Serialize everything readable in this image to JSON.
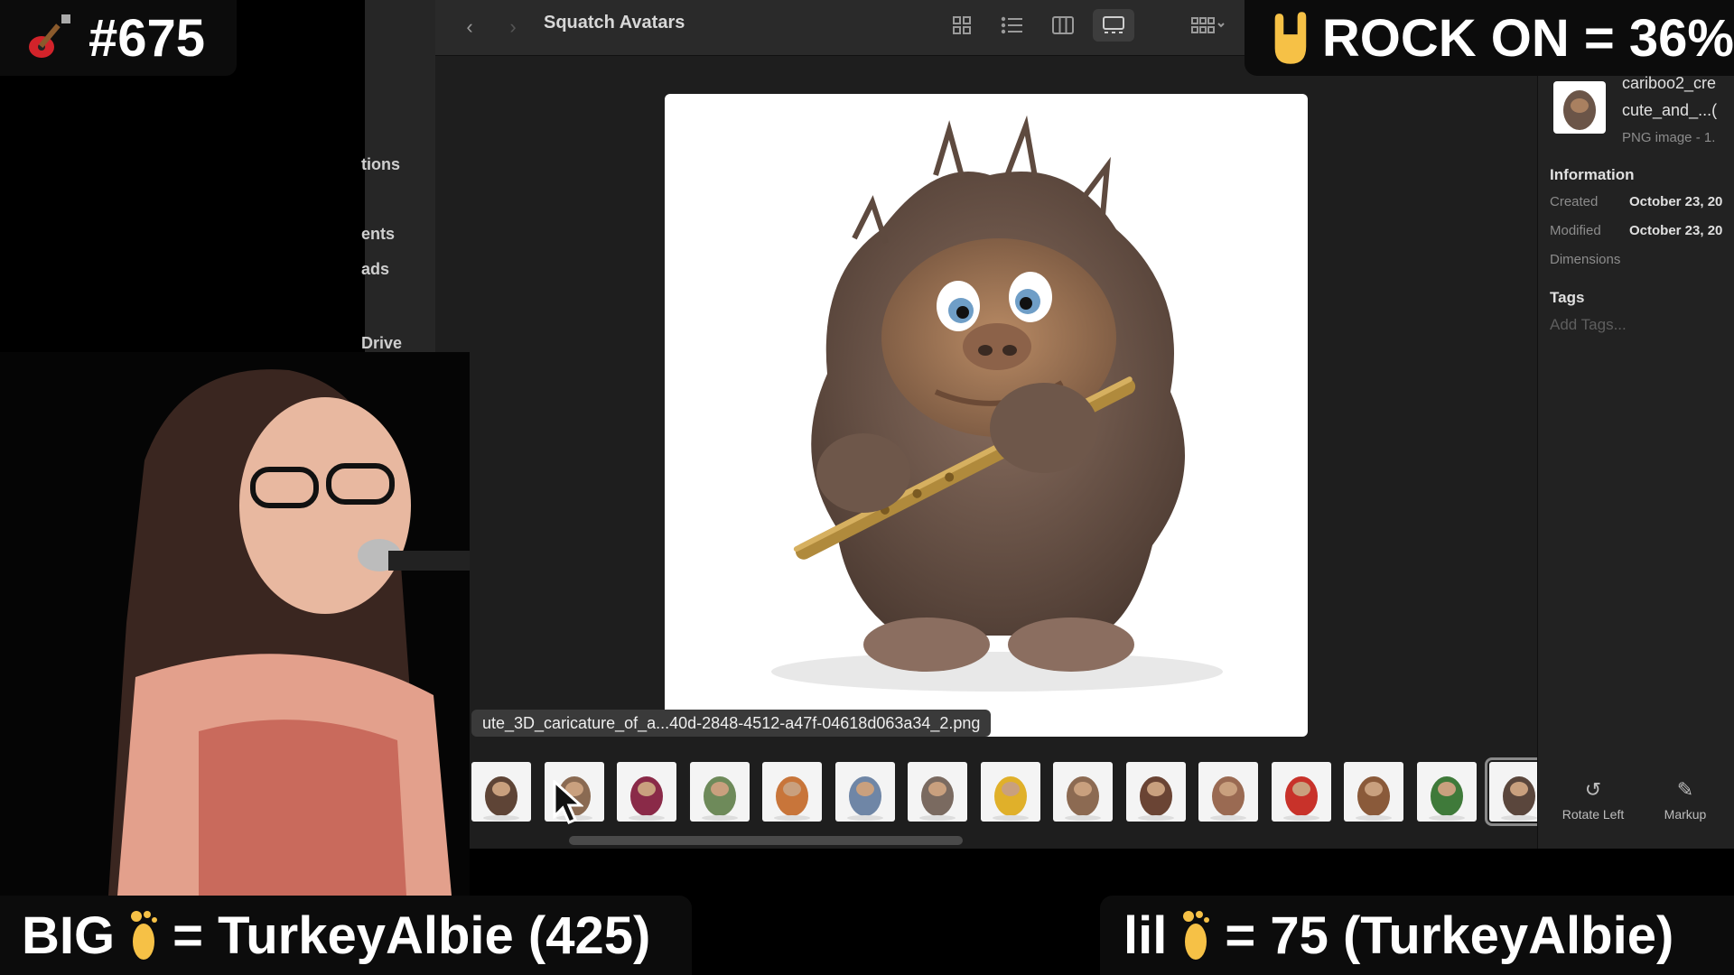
{
  "overlay": {
    "episode": "#675",
    "rock_on": "ROCK ON = 36%",
    "big_foot": "= TurkeyAlbie (425)",
    "big_label": "BIG",
    "lil_label": "lil",
    "lil_foot": "=  75 (TurkeyAlbie)"
  },
  "finder": {
    "title": "Squatch Avatars",
    "sidebar_items": [
      "tions",
      "ents",
      "ads",
      "Drive"
    ],
    "filename_tooltip": "ute_3D_caricature_of_a...40d-2848-4512-a47f-04618d063a34_2.png",
    "thumbnail_count": 15,
    "selected_thumbnail_index": 14
  },
  "inspector": {
    "file_name_line1": "cariboo2_cre",
    "file_name_line2": "cute_and_...(",
    "kind": "PNG image - 1.",
    "information_heading": "Information",
    "created_label": "Created",
    "created_value": "October 23, 20",
    "modified_label": "Modified",
    "modified_value": "October 23, 20",
    "dimensions_label": "Dimensions",
    "tags_heading": "Tags",
    "tags_placeholder": "Add Tags...",
    "rotate_label": "Rotate Left",
    "markup_label": "Markup"
  },
  "colors": {
    "overlay_bg": "#0c0c0c",
    "window_bg": "#1e1e1e",
    "fur": "#6b5548"
  }
}
